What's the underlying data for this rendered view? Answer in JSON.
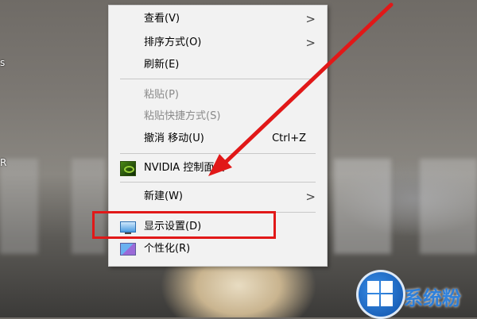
{
  "desktop": {
    "edge_fragments": [
      "s",
      "R"
    ]
  },
  "context_menu": {
    "items": [
      {
        "label": "查看(V)",
        "submenu": true
      },
      {
        "label": "排序方式(O)",
        "submenu": true
      },
      {
        "label": "刷新(E)"
      },
      {
        "label": "粘贴(P)",
        "disabled": true
      },
      {
        "label": "粘贴快捷方式(S)",
        "disabled": true
      },
      {
        "label": "撤消 移动(U)",
        "shortcut": "Ctrl+Z"
      },
      {
        "label": "NVIDIA 控制面板",
        "icon": "nvidia-icon"
      },
      {
        "label": "新建(W)",
        "submenu": true
      },
      {
        "label": "显示设置(D)",
        "icon": "display-icon",
        "highlighted": true
      },
      {
        "label": "个性化(R)",
        "icon": "personalize-icon"
      }
    ],
    "submenu_arrow": ">"
  },
  "annotation": {
    "color": "#e11818"
  },
  "watermark": {
    "text": "系统粉"
  }
}
